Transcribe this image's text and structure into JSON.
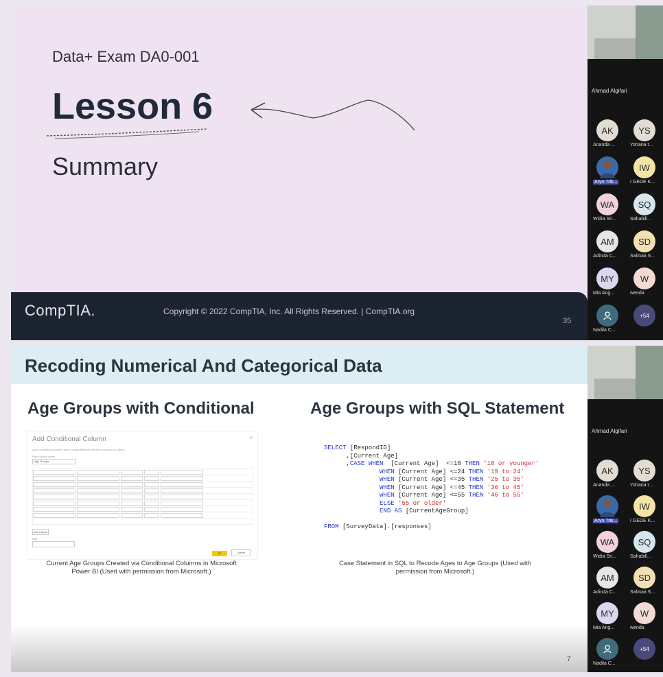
{
  "slide1": {
    "subtitle": "Data+ Exam DA0-001",
    "title": "Lesson 6",
    "summary": "Summary",
    "logo": "CompTIA.",
    "copyright": "Copyright © 2022 CompTIA, Inc. All Rights Reserved.  |  CompTIA.org",
    "page": "35"
  },
  "gallery": {
    "host": "Ahmad Algifari",
    "participants": [
      {
        "initials": "AK",
        "name": "Ananda ...",
        "color": "#e3dcd2"
      },
      {
        "initials": "YS",
        "name": "Yohana t...",
        "color": "#e3dcd2"
      },
      {
        "initials": "",
        "name": "Aryo Trik...",
        "color": "#3a6aa8",
        "photo": true
      },
      {
        "initials": "IW",
        "name": "I GEDE K...",
        "color": "#f4e4a6"
      },
      {
        "initials": "WA",
        "name": "Widia Sri...",
        "color": "#f1d2de"
      },
      {
        "initials": "SQ",
        "name": "Sahabill...",
        "color": "#d6e5ee"
      },
      {
        "initials": "AM",
        "name": "Adinda C...",
        "color": "#e6e6e2"
      },
      {
        "initials": "SD",
        "name": "Salmaa S...",
        "color": "#f3dfb4"
      },
      {
        "initials": "MY",
        "name": "Mia Ang...",
        "color": "#dcd7f0"
      },
      {
        "initials": "W",
        "name": "wenda",
        "color": "#f3dbd3"
      },
      {
        "initials": "",
        "name": "Nadila C...",
        "color": "#3f6b7a",
        "icon": "user-icon"
      },
      {
        "initials": "+54",
        "name": "",
        "color": "#4a4a7a"
      }
    ]
  },
  "slide2": {
    "title": "Recoding Numerical And Categorical Data",
    "left_heading": "Age Groups with Conditional",
    "right_heading": "Age Groups with SQL Statement",
    "dialog": {
      "title": "Add Conditional Column",
      "close": "×",
      "description": "Add a conditional column that is computed from the other columns or values.",
      "name_label": "New column name",
      "name_value": "Age Groups",
      "add_clause": "Add Clause",
      "else_label": "Else",
      "ok": "OK",
      "cancel": "Cancel"
    },
    "left_caption": "Current Age Groups Created via Conditional Columns in Microsoft Power BI (Used with permission from Microsoft.)",
    "sql": {
      "l1_kw": "SELECT",
      "l1": " [RespondID]",
      "l2": "      ,[Current Age]",
      "l3_pre": "      ,",
      "l3_kw1": "CASE WHEN",
      "l3_mid": "  [Current Age]  <=18 ",
      "l3_kw2": "THEN",
      "l3_str": " '18 or younger'",
      "w1_mid": " [Current Age] <=24 ",
      "w1_str": " '19 to 24'",
      "w2_mid": " [Current Age] <=35 ",
      "w2_str": " '25 to 35'",
      "w3_mid": " [Current Age] <=45 ",
      "w3_str": " '36 to 45'",
      "w4_mid": " [Current Age] <=55 ",
      "w4_str": " '46 to 55'",
      "when": "WHEN",
      "then": "THEN",
      "else_kw": "ELSE",
      "else_str": " '55 or older'",
      "end_kw": "END AS",
      "end_rest": " [CurrentAgeGroup]",
      "from_kw": "FROM",
      "from_rest": " [SurveyData].[responses]"
    },
    "right_caption": "Case Statement in SQL to Recode Ages to Age Groups (Used with permission from Microsoft.)",
    "page": "7"
  }
}
